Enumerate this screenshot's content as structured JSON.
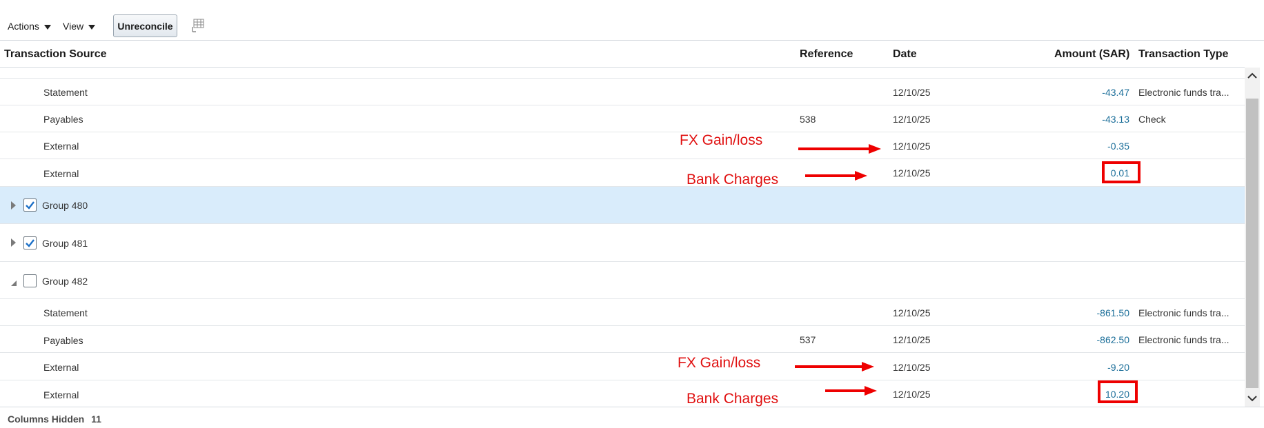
{
  "toolbar": {
    "actions_label": "Actions",
    "view_label": "View",
    "unreconcile_label": "Unreconcile"
  },
  "columns": {
    "source": "Transaction Source",
    "reference": "Reference",
    "date": "Date",
    "amount": "Amount (SAR)",
    "type": "Transaction Type"
  },
  "rows": [
    {
      "source": "Statement",
      "reference": "",
      "date": "12/10/25",
      "amount": "-43.47",
      "type": "Electronic funds tra..."
    },
    {
      "source": "Payables",
      "reference": "538",
      "date": "12/10/25",
      "amount": "-43.13",
      "type": "Check"
    },
    {
      "source": "External",
      "reference": "",
      "date": "12/10/25",
      "amount": "-0.35",
      "type": ""
    },
    {
      "source": "External",
      "reference": "",
      "date": "12/10/25",
      "amount": "0.01",
      "type": ""
    },
    {
      "group": "Group 480",
      "checked": true,
      "expanded": false,
      "selected": true
    },
    {
      "group": "Group 481",
      "checked": true,
      "expanded": false,
      "selected": false
    },
    {
      "group": "Group 482",
      "checked": false,
      "expanded": true,
      "selected": false
    },
    {
      "source": "Statement",
      "reference": "",
      "date": "12/10/25",
      "amount": "-861.50",
      "type": "Electronic funds tra..."
    },
    {
      "source": "Payables",
      "reference": "537",
      "date": "12/10/25",
      "amount": "-862.50",
      "type": "Electronic funds tra..."
    },
    {
      "source": "External",
      "reference": "",
      "date": "12/10/25",
      "amount": "-9.20",
      "type": ""
    },
    {
      "source": "External",
      "reference": "",
      "date": "12/10/25",
      "amount": "10.20",
      "type": ""
    }
  ],
  "footer": {
    "label": "Columns Hidden",
    "count": "11"
  },
  "annotations": {
    "fx_1": "FX Gain/loss",
    "bank_1": "Bank Charges",
    "fx_2": "FX Gain/loss",
    "bank_2": "Bank Charges",
    "color": "#ee0000"
  },
  "colors": {
    "amount": "#1b6e99",
    "selected_row": "#d9ecfb",
    "checkbox_checked": "#1b6fc7"
  },
  "icons": {
    "actions": "caret-down-icon",
    "view": "caret-down-icon",
    "detach": "table-detach-icon",
    "expand": "triangle-right-icon",
    "collapse": "triangle-down-icon",
    "scroll_up": "chevron-up-icon",
    "scroll_down": "chevron-down-icon"
  }
}
